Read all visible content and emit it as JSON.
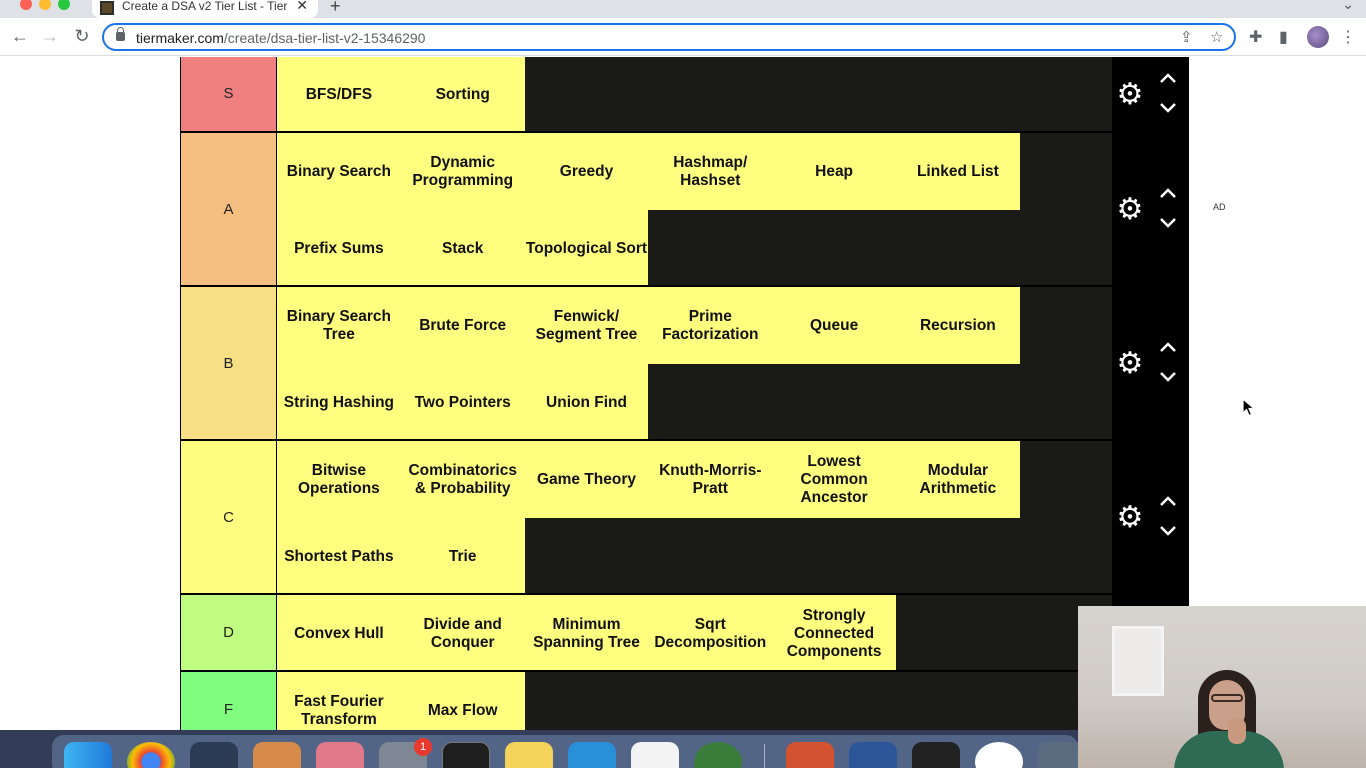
{
  "browser": {
    "tab": {
      "title": "Create a DSA v2 Tier List - Tier",
      "close": "✕"
    },
    "new_tab": "+",
    "url_host": "tiermaker.com",
    "url_path": "/create/dsa-tier-list-v2-15346290"
  },
  "tiers": [
    {
      "label": "S",
      "color": "#f08080",
      "items": [
        "BFS/DFS",
        "Sorting"
      ]
    },
    {
      "label": "A",
      "color": "#f4bf80",
      "items": [
        "Binary Search",
        "Dynamic Programming",
        "Greedy",
        "Hashmap/ Hashset",
        "Heap",
        "Linked List",
        "Prefix Sums",
        "Stack",
        "Topological Sort"
      ]
    },
    {
      "label": "B",
      "color": "#f7df85",
      "items": [
        "Binary Search Tree",
        "Brute Force",
        "Fenwick/ Segment Tree",
        "Prime Factorization",
        "Queue",
        "Recursion",
        "String Hashing",
        "Two Pointers",
        "Union Find"
      ]
    },
    {
      "label": "C",
      "color": "#fdfd80",
      "items": [
        "Bitwise Operations",
        "Combinatorics & Probability",
        "Game Theory",
        "Knuth-Morris-Pratt",
        "Lowest Common Ancestor",
        "Modular Arithmetic",
        "Shortest Paths",
        "Trie"
      ]
    },
    {
      "label": "D",
      "color": "#c0fc7f",
      "items": [
        "Convex Hull",
        "Divide and Conquer",
        "Minimum Spanning Tree",
        "Sqrt Decomposition",
        "Strongly Connected Components"
      ]
    },
    {
      "label": "F",
      "color": "#80fc7f",
      "items": [
        "Fast Fourier Transform",
        "Max Flow"
      ]
    }
  ],
  "item_color": "#ffff7f",
  "ad_label": "AD",
  "dock": {
    "notification_badge": "1"
  },
  "icons": {
    "settings": "gear-icon",
    "move_up": "chevron-up-icon",
    "move_down": "chevron-down-icon"
  }
}
